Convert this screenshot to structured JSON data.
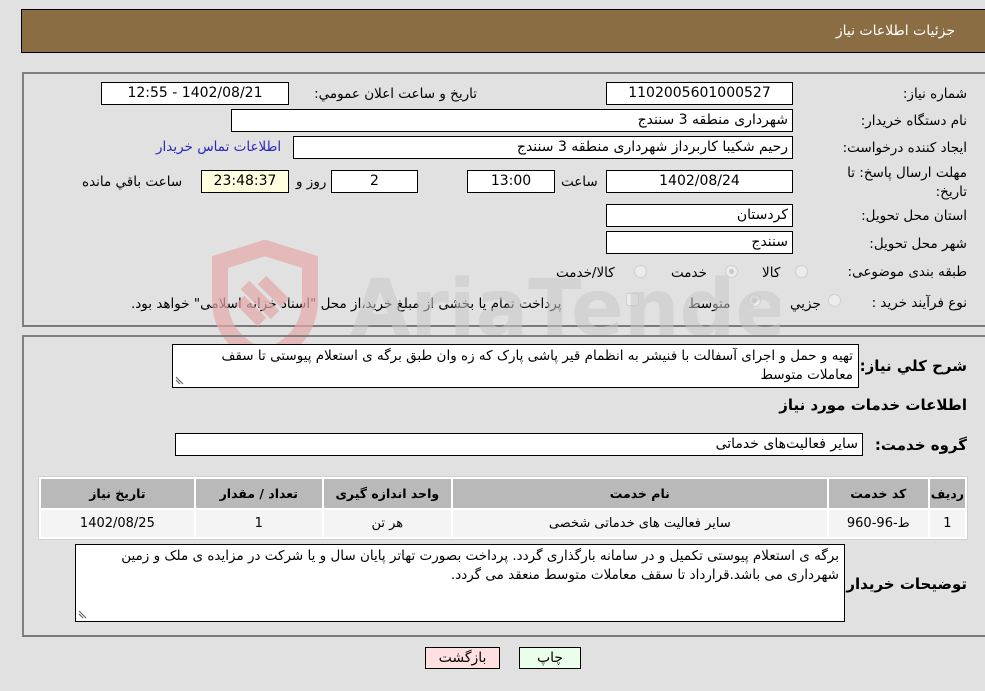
{
  "header": {
    "title": "جزئیات اطلاعات نیاز"
  },
  "details": {
    "need_number_label": "شماره نیاز:",
    "need_number": "1102005601000527",
    "announce_label": "تاریخ و ساعت اعلان عمومي:",
    "announce_value": "1402/08/21 - 12:55",
    "buyer_org_label": "نام دستگاه خريدار:",
    "buyer_org": "شهرداری منطقه 3 سنندج",
    "creator_label": "ايجاد کننده درخواست:",
    "creator": "رحیم شکیبا کاربرداز شهرداری منطقه 3 سنندج",
    "contact_link": "اطلاعات تماس خريدار",
    "deadline_label": "مهلت ارسال پاسخ: تا تاریخ:",
    "deadline_date": "1402/08/24",
    "time_label": "ساعت",
    "deadline_time": "13:00",
    "days_value": "2",
    "days_label": "روز و",
    "remaining_time": "23:48:37",
    "remaining_label": "ساعت باقي مانده",
    "province_label": "استان محل تحويل:",
    "province": "کردستان",
    "city_label": "شهر محل تحويل:",
    "city": "سنندج",
    "category_label": "طبقه بندی موضوعی:",
    "category_options": [
      {
        "label": "کالا",
        "checked": false
      },
      {
        "label": "خدمت",
        "checked": true
      },
      {
        "label": "کالا/خدمت",
        "checked": false
      }
    ],
    "purchase_type_label": "نوع فرآيند خريد :",
    "purchase_type_options": [
      {
        "label": "جزيي",
        "checked": false
      },
      {
        "label": "متوسط",
        "checked": true
      }
    ],
    "treasury_note": "پرداخت تمام يا بخشی از مبلغ خريد،از محل \"اسناد خزانه اسلامی\" خواهد بود.",
    "treasury_checked": false
  },
  "need": {
    "description_label": "شرح کلي نياز:",
    "description": "تهیه  و حمل و اجرای آسفالت با فنیشر به انظمام قیر پاشی پارک که زه وان طبق برگه ی استعلام پیوستی تا سقف معاملات متوسط",
    "services_heading": "اطلاعات خدمات مورد نياز",
    "service_group_label": "گروه خدمت:",
    "service_group": "ساير فعاليت‌هاى خدماتى"
  },
  "table": {
    "columns": [
      "رديف",
      "کد خدمت",
      "نام خدمت",
      "واحد اندازه گيری",
      "تعداد / مقدار",
      "تاريخ نياز"
    ],
    "rows": [
      [
        "1",
        "ط-96-960",
        "ساير فعاليت های خدماتی شخصی",
        "هر تن",
        "1",
        "1402/08/25"
      ]
    ]
  },
  "buyer_notes": {
    "label": "توضيحات خريدار:",
    "text": "برگه ی استعلام پیوستی تکمیل و در سامانه بارگذاری گردد. پرداخت بصورت تهاتر پایان سال و یا شرکت در مزایده ی ملک و زمین شهرداری می باشد.قرارداد تا سقف معاملات متوسط منعقد می گردد."
  },
  "buttons": {
    "print": "چاپ",
    "back": "بازگشت"
  },
  "watermark": {
    "text": "AriaTender.neT"
  }
}
